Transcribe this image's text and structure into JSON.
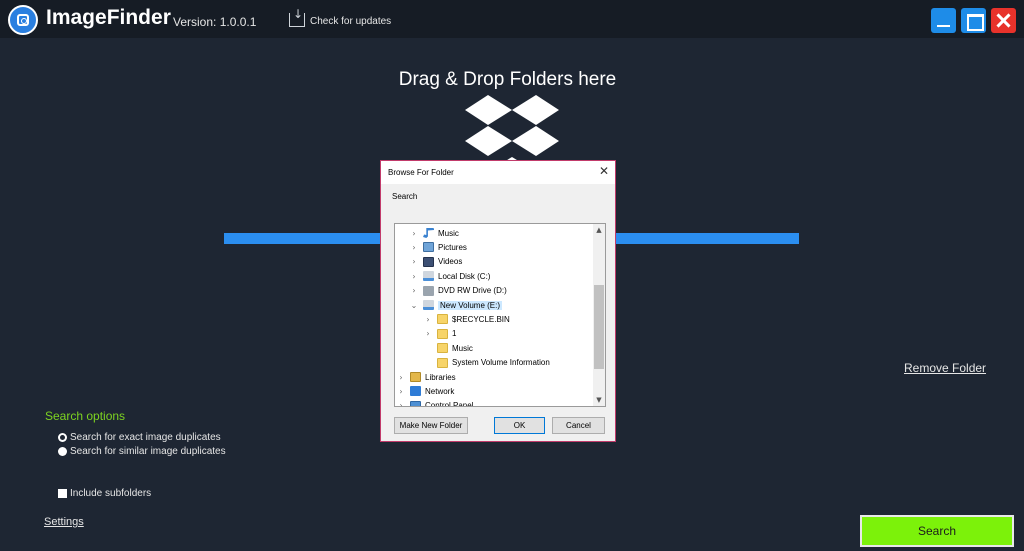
{
  "app": {
    "title": "ImageFinder",
    "version": "Version: 1.0.0.1",
    "check_updates": "Check for updates"
  },
  "dropzone": {
    "title": "Drag & Drop Folders here",
    "progress_percent": 100
  },
  "remove_folder": "Remove Folder",
  "options": {
    "title": "Search options",
    "radio_exact": "Search for exact image duplicates",
    "radio_similar": "Search for similar image duplicates",
    "selected": "exact",
    "include_subfolders": "Include subfolders",
    "include_subfolders_checked": false
  },
  "settings_link": "Settings",
  "search_button": "Search",
  "dialog": {
    "title": "Browse For Folder",
    "close": "✕",
    "search_label": "Search",
    "tree": [
      {
        "label": "Music",
        "icon": "music-icon",
        "expandable": true,
        "expanded": false,
        "level": 1
      },
      {
        "label": "Pictures",
        "icon": "pictures-icon",
        "expandable": true,
        "expanded": false,
        "level": 1
      },
      {
        "label": "Videos",
        "icon": "videos-icon",
        "expandable": true,
        "expanded": false,
        "level": 1
      },
      {
        "label": "Local Disk (C:)",
        "icon": "drive-icon",
        "expandable": true,
        "expanded": false,
        "level": 1
      },
      {
        "label": "DVD RW Drive (D:)",
        "icon": "dvd-icon",
        "expandable": true,
        "expanded": false,
        "level": 1
      },
      {
        "label": "New Volume (E:)",
        "icon": "drive-icon",
        "expandable": true,
        "expanded": true,
        "selected": true,
        "level": 1
      },
      {
        "label": "$RECYCLE.BIN",
        "icon": "folder-icon",
        "expandable": true,
        "expanded": false,
        "level": 2
      },
      {
        "label": "1",
        "icon": "folder-icon",
        "expandable": true,
        "expanded": false,
        "level": 2
      },
      {
        "label": "Music",
        "icon": "folder-icon",
        "expandable": false,
        "level": 2
      },
      {
        "label": "System Volume Information",
        "icon": "folder-icon",
        "expandable": false,
        "level": 2
      },
      {
        "label": "Libraries",
        "icon": "libraries-icon",
        "expandable": true,
        "expanded": false,
        "level": 0
      },
      {
        "label": "Network",
        "icon": "network-icon",
        "expandable": true,
        "expanded": false,
        "level": 0
      },
      {
        "label": "Control Panel",
        "icon": "control-panel-icon",
        "expandable": true,
        "expanded": false,
        "level": 0
      }
    ],
    "buttons": {
      "new_folder": "Make New Folder",
      "ok": "OK",
      "cancel": "Cancel"
    }
  },
  "colors": {
    "background": "#1e2633",
    "titlebar": "#161c25",
    "accent_blue": "#2b8ef0",
    "accent_green": "#7cf20a",
    "options_title": "#7dd321",
    "close_red": "#e8322b",
    "dialog_border": "#c23b6b"
  }
}
